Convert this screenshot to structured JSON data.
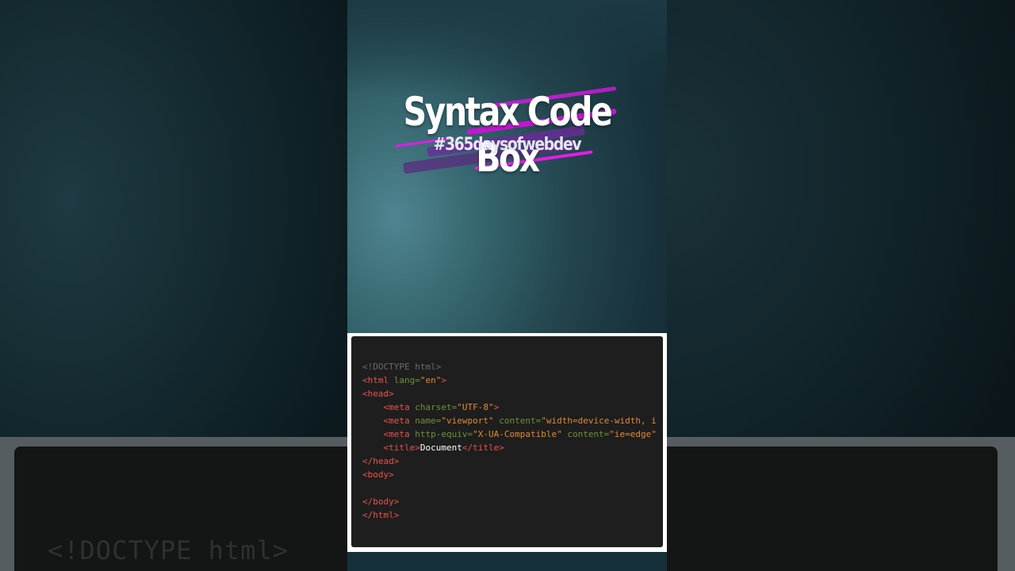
{
  "video": {
    "title": "Syntax Code Box",
    "hashtag": "#365daysofwebdev"
  },
  "background": {
    "code_preview": "<!DOCTYPE html>"
  },
  "code_box": {
    "lines": [
      {
        "parts": [
          {
            "t": "doctype",
            "v": "<!DOCTYPE html>"
          }
        ]
      },
      {
        "parts": [
          {
            "t": "tag",
            "v": "<html "
          },
          {
            "t": "attr",
            "v": "lang="
          },
          {
            "t": "val",
            "v": "\"en\""
          },
          {
            "t": "tag",
            "v": ">"
          }
        ]
      },
      {
        "parts": [
          {
            "t": "tag",
            "v": "<head>"
          }
        ]
      },
      {
        "parts": [
          {
            "t": "plain",
            "v": "    "
          },
          {
            "t": "tag",
            "v": "<meta "
          },
          {
            "t": "attr",
            "v": "charset="
          },
          {
            "t": "val",
            "v": "\"UTF-8\""
          },
          {
            "t": "tag",
            "v": ">"
          }
        ]
      },
      {
        "parts": [
          {
            "t": "plain",
            "v": "    "
          },
          {
            "t": "tag",
            "v": "<meta "
          },
          {
            "t": "attr",
            "v": "name="
          },
          {
            "t": "val",
            "v": "\"viewport\""
          },
          {
            "t": "attr",
            "v": " content="
          },
          {
            "t": "val",
            "v": "\"width=device-width, i"
          }
        ]
      },
      {
        "parts": [
          {
            "t": "plain",
            "v": "    "
          },
          {
            "t": "tag",
            "v": "<meta "
          },
          {
            "t": "attr",
            "v": "http-equiv="
          },
          {
            "t": "val",
            "v": "\"X-UA-Compatible\""
          },
          {
            "t": "attr",
            "v": " content="
          },
          {
            "t": "val",
            "v": "\"ie=edge\""
          }
        ]
      },
      {
        "parts": [
          {
            "t": "plain",
            "v": "    "
          },
          {
            "t": "tag",
            "v": "<title>"
          },
          {
            "t": "text",
            "v": "Document"
          },
          {
            "t": "tag",
            "v": "</title>"
          }
        ]
      },
      {
        "parts": [
          {
            "t": "tag",
            "v": "</head>"
          }
        ]
      },
      {
        "parts": [
          {
            "t": "tag",
            "v": "<body>"
          }
        ]
      },
      {
        "parts": []
      },
      {
        "parts": [
          {
            "t": "tag",
            "v": "</body>"
          }
        ]
      },
      {
        "parts": [
          {
            "t": "tag",
            "v": "</html>"
          }
        ]
      }
    ],
    "colors": {
      "tag": "#e8534e",
      "attr": "#6f8f37",
      "val": "#e0882e",
      "doctype": "#6a6a6a",
      "text": "#ffffff",
      "background": "#1e1e1e"
    }
  }
}
